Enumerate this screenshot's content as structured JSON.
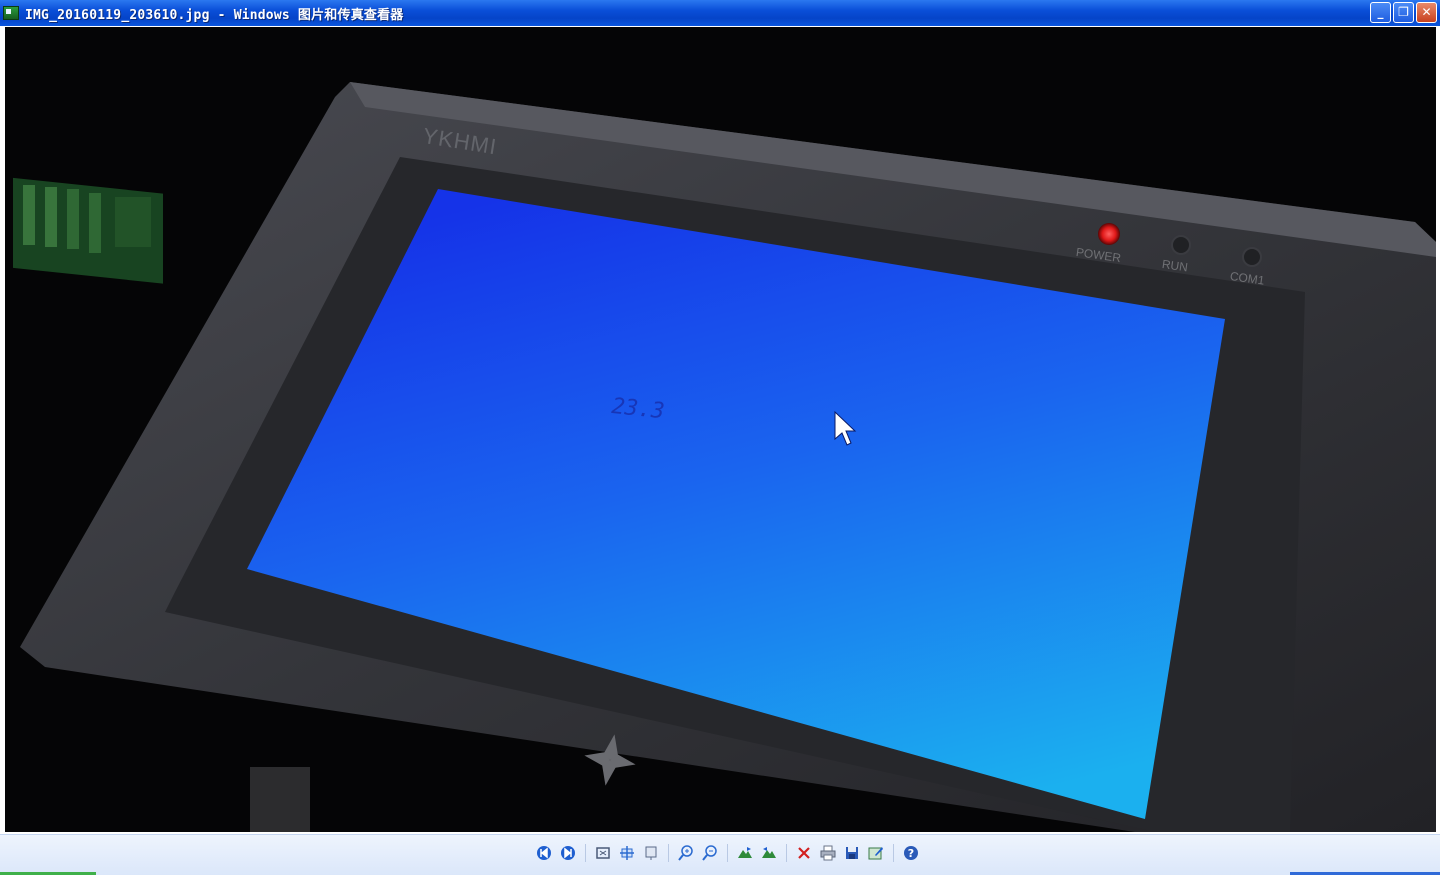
{
  "window": {
    "title": "IMG_20160119_203610.jpg - Windows 图片和传真查看器",
    "controls": {
      "minimize": "_",
      "restore": "❐",
      "close": "✕"
    }
  },
  "photo": {
    "screen_reading": "23.3",
    "brand": "YKHMI",
    "leds": [
      {
        "label": "POWER",
        "state": "on",
        "color": "#e01818"
      },
      {
        "label": "RUN",
        "state": "off",
        "color": "#2a2a2a"
      },
      {
        "label": "COM1",
        "state": "off",
        "color": "#2a2a2a"
      }
    ]
  },
  "toolbar": {
    "buttons": [
      {
        "name": "previous-image",
        "icon": "previous-icon",
        "glyph": "⏮"
      },
      {
        "name": "next-image",
        "icon": "next-icon",
        "glyph": "⏭"
      },
      {
        "name": "best-fit",
        "icon": "best-fit-icon",
        "glyph": "⛶"
      },
      {
        "name": "actual-size",
        "icon": "actual-size-icon",
        "glyph": "✥"
      },
      {
        "name": "slideshow",
        "icon": "slideshow-icon",
        "glyph": "▣"
      },
      {
        "name": "zoom-in",
        "icon": "zoom-in-icon",
        "glyph": "⊕"
      },
      {
        "name": "zoom-out",
        "icon": "zoom-out-icon",
        "glyph": "⊖"
      },
      {
        "name": "rotate-clockwise",
        "icon": "rotate-cw-icon",
        "glyph": "▲"
      },
      {
        "name": "rotate-counterclockwise",
        "icon": "rotate-ccw-icon",
        "glyph": "▲"
      },
      {
        "name": "delete",
        "icon": "delete-icon",
        "glyph": "✕"
      },
      {
        "name": "print",
        "icon": "print-icon",
        "glyph": "⎙"
      },
      {
        "name": "save-copy",
        "icon": "save-icon",
        "glyph": "▪"
      },
      {
        "name": "open-for-editing",
        "icon": "edit-icon",
        "glyph": "✎"
      },
      {
        "name": "help",
        "icon": "help-icon",
        "glyph": "?"
      }
    ]
  },
  "colors": {
    "titlebar": "#0a4fd8",
    "toolbar": "#dbe7fa",
    "screen_top": "#1a3cf0",
    "screen_bottom": "#1ea8ee",
    "bezel": "#3a3b40"
  }
}
